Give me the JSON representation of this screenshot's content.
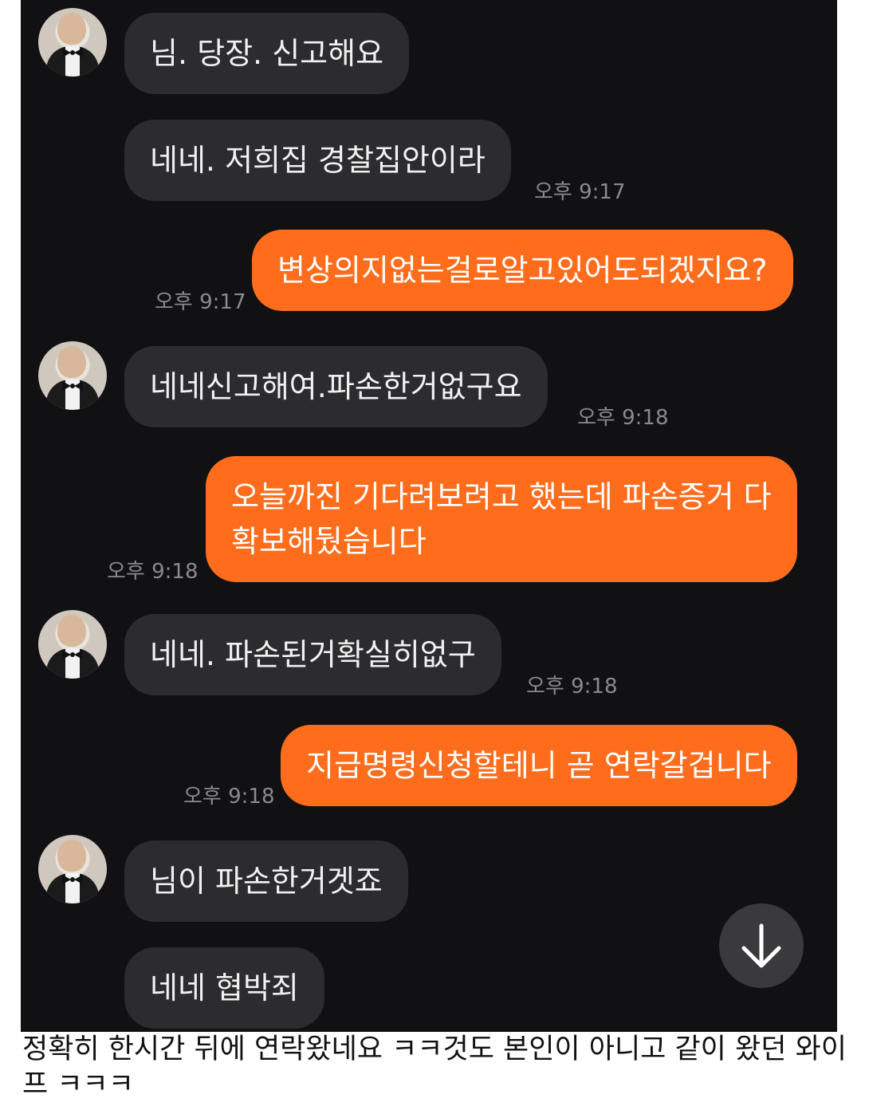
{
  "chat": {
    "messages": [
      {
        "side": "in",
        "text": "님. 당장. 신고해요",
        "time": ""
      },
      {
        "side": "in",
        "text": "네네. 저희집 경찰집안이라",
        "time": "오후 9:17"
      },
      {
        "side": "out",
        "text": "변상의지없는걸로알고있어도되겠지요?",
        "time": "오후 9:17"
      },
      {
        "side": "in",
        "text": "네네신고해여.파손한거없구요",
        "time": "오후 9:18"
      },
      {
        "side": "out",
        "text_line1": "오늘까진 기다려보려고 했는데 파손증거 다",
        "text_line2": "확보해뒀습니다",
        "time": "오후 9:18"
      },
      {
        "side": "in",
        "text": "네네. 파손된거확실히없구",
        "time": "오후 9:18"
      },
      {
        "side": "out",
        "text": "지급명령신청할테니 곧 연락갈겁니다",
        "time": "오후 9:18"
      },
      {
        "side": "in",
        "text": "님이 파손한거겟죠",
        "time": ""
      },
      {
        "side": "in",
        "text": "네네 협박죄",
        "time": ""
      }
    ],
    "scroll_down_icon": "arrow-down-icon",
    "colors": {
      "background": "#111113",
      "incoming": "#2c2c2f",
      "outgoing": "#ff6d1c"
    }
  },
  "caption": "정확히 한시간 뒤에 연락왔네요 ㅋㅋ것도 본인이 아니고 같이 왔던 와이프 ㅋㅋㅋ"
}
